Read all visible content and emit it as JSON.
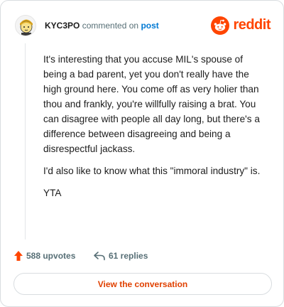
{
  "comment": {
    "author": "KYC3PO",
    "action_text": "commented on",
    "link_text": "post",
    "paragraphs": [
      "It's interesting that you accuse MIL's spouse of being a bad parent, yet you don't really have the high ground here. You come off as very holier than thou and frankly, you're willfully raising a brat. You can disagree with people all day long, but there's a difference between disagreeing and being a disrespectful jackass.",
      "I'd also like to know what this \"immoral industry\" is.",
      "YTA"
    ]
  },
  "brand": {
    "wordmark": "reddit",
    "color": "#ff4500"
  },
  "stats": {
    "upvotes_label": "588 upvotes",
    "replies_label": "61 replies",
    "upvote_icon": "upvote-arrow-icon",
    "reply_icon": "reply-arrow-icon"
  },
  "cta": {
    "label": "View the conversation"
  },
  "colors": {
    "link": "#0079d3",
    "accent": "#ff4500",
    "muted": "#576f76"
  }
}
